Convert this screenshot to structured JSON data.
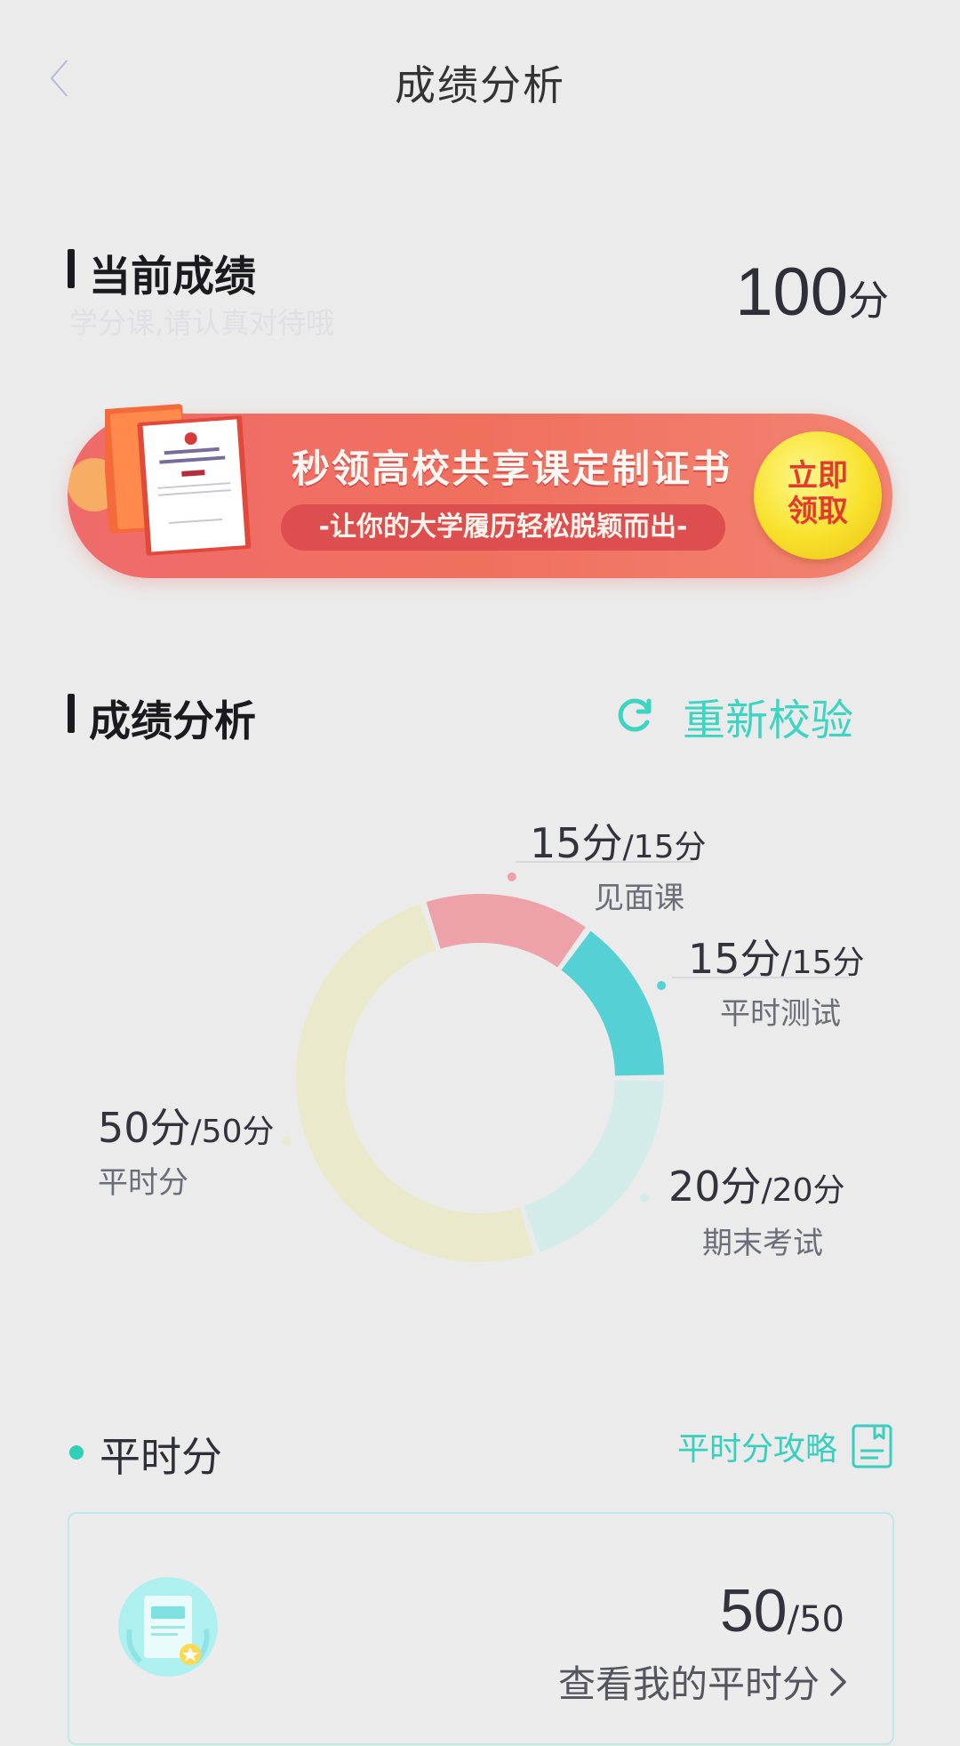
{
  "header": {
    "title": "成绩分析"
  },
  "current_score": {
    "heading": "当前成绩",
    "hint": "学分课,请认真对待哦",
    "value": "100",
    "unit": "分"
  },
  "banner": {
    "title": "秒领高校共享课定制证书",
    "subtitle": "-让你的大学履历轻松脱颖而出-",
    "claim_line1": "立即",
    "claim_line2": "领取"
  },
  "analysis": {
    "heading": "成绩分析",
    "recheck_label": "重新校验",
    "colors": {
      "face_to_face": "#eca2a8",
      "tests": "#55d1d6",
      "final_exam": "#d3ecea",
      "usual": "#ebe9cc"
    },
    "items": [
      {
        "name": "见面课",
        "score": "15分",
        "total": "/15分",
        "value": 15
      },
      {
        "name": "平时测试",
        "score": "15分",
        "total": "/15分",
        "value": 15
      },
      {
        "name": "期末考试",
        "score": "20分",
        "total": "/20分",
        "value": 20
      },
      {
        "name": "平时分",
        "score": "50分",
        "total": "/50分",
        "value": 50
      }
    ]
  },
  "usual": {
    "label": "平时分",
    "guide_label": "平时分攻略",
    "card_score": "50",
    "card_total": "/50",
    "card_link": "查看我的平时分"
  }
}
